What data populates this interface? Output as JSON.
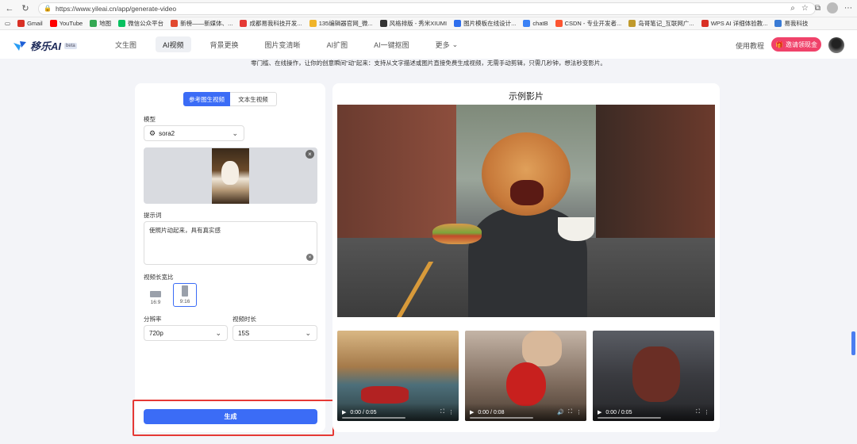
{
  "browser": {
    "url": "https://www.yileai.cn/app/generate-video",
    "bookmarks": [
      {
        "label": "Gmail",
        "color": "#d93025"
      },
      {
        "label": "YouTube",
        "color": "#ff0000"
      },
      {
        "label": "地图",
        "color": "#34a853"
      },
      {
        "label": "微信公众平台",
        "color": "#07c160"
      },
      {
        "label": "新榜——新媒体、...",
        "color": "#e2492f"
      },
      {
        "label": "成都易我科技开发...",
        "color": "#e53935"
      },
      {
        "label": "135编辑器官网_微...",
        "color": "#f0b429"
      },
      {
        "label": "风格排版 - 秀米XIUMI",
        "color": "#333333"
      },
      {
        "label": "图片模板在线设计...",
        "color": "#2f6fed"
      },
      {
        "label": "chatB",
        "color": "#3b82f6"
      },
      {
        "label": "CSDN - 专业开发者...",
        "color": "#fc5531"
      },
      {
        "label": "岛哥笔记_互联网广...",
        "color": "#c09a2c"
      },
      {
        "label": "WPS AI 详细体验教...",
        "color": "#d93025"
      },
      {
        "label": "易我科技",
        "color": "#3a7bd5"
      }
    ]
  },
  "header": {
    "logo_text": "移乐AI",
    "logo_badge": "beta",
    "nav": [
      "文生图",
      "AI视频",
      "背景更换",
      "图片变清晰",
      "AI扩图",
      "AI一键抠图",
      "更多"
    ],
    "nav_active_index": 1,
    "tutorial": "使用教程",
    "invite_button": "邀请领现金"
  },
  "tagline": "零门槛、在线操作，让你的创意瞬间\"动\"起来：支持从文字描述或图片直接免费生成视频，无需手动剪辑，只需几秒钟，想法秒变影片。",
  "form": {
    "tabs": [
      "参考图生视频",
      "文本生视频"
    ],
    "model_label": "模型",
    "model_value": "sora2",
    "prompt_label": "提示词",
    "prompt_value": "使照片动起来，具有真实感",
    "ratio_label": "视频长宽比",
    "ratios": [
      {
        "label": "16:9",
        "selected": false
      },
      {
        "label": "9:16",
        "selected": true
      }
    ],
    "resolution_label": "分辨率",
    "resolution_value": "720p",
    "duration_label": "视频时长",
    "duration_value": "15S",
    "generate_button": "生成"
  },
  "examples": {
    "title": "示例影片",
    "thumbnails": [
      {
        "time": "0:00 / 0:05"
      },
      {
        "time": "0:00 / 0:08"
      },
      {
        "time": "0:00 / 0:05"
      }
    ]
  },
  "colors": {
    "primary": "#3b6cf6",
    "invite": "#f0426a",
    "highlight": "#e53935"
  }
}
